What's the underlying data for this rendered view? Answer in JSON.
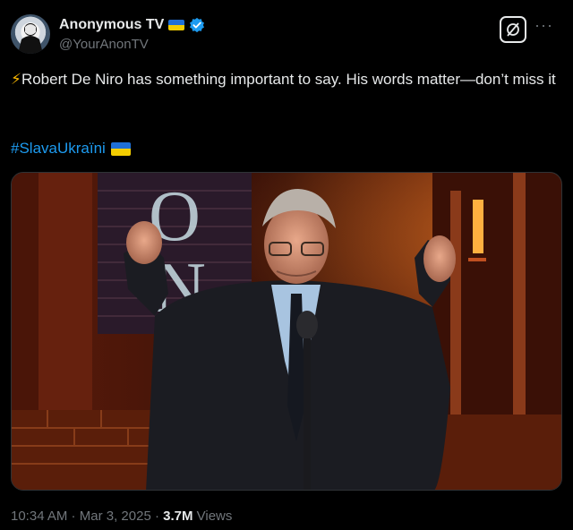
{
  "author": {
    "display_name": "Anonymous TV",
    "handle": "@YourAnonTV",
    "flag_colors": [
      "#1f6fd6",
      "#f3cd00"
    ],
    "verified_color": "#1d9bf0"
  },
  "tweet": {
    "emoji": "⚡",
    "text": "Robert De Niro has something important to say. His words matter—don’t miss it",
    "hashtag": "#SlavaUkraїni"
  },
  "meta": {
    "time": "10:34 AM",
    "sep1": " · ",
    "date": "Mar 3, 2025",
    "sep2": " · ",
    "views_count": "3.7M",
    "views_label": " Views"
  },
  "media": {
    "letters": [
      "O",
      "N"
    ]
  },
  "icons": {
    "grok": "grok-icon",
    "more": "more-icon",
    "verified": "verified-badge-icon"
  }
}
